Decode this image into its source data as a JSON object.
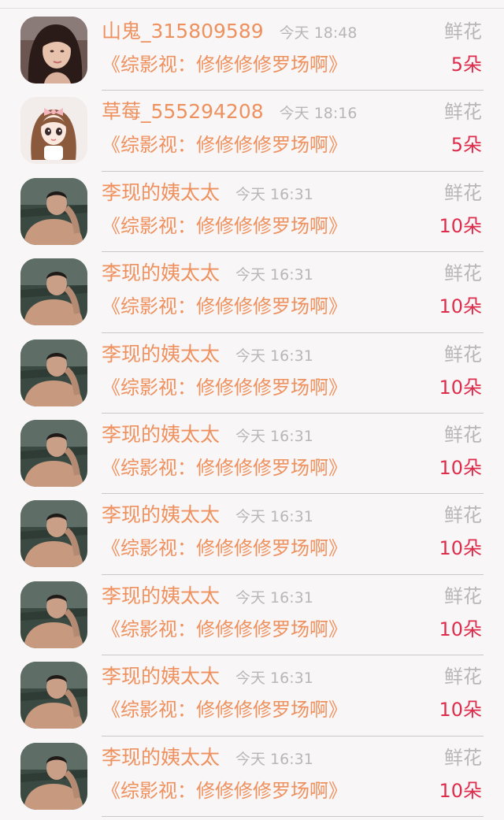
{
  "items": [
    {
      "name": "山鬼_315809589",
      "time": "今天 18:48",
      "gift": "鲜花",
      "book": "《综影视：修修修修罗场啊》",
      "count": "5朵",
      "avatar": "girl-dark-hair-avatar"
    },
    {
      "name": "草莓_555294208",
      "time": "今天 18:16",
      "gift": "鲜花",
      "book": "《综影视：修修修修罗场啊》",
      "count": "5朵",
      "avatar": "doll-girl-avatar"
    },
    {
      "name": "李现的姨太太",
      "time": "今天 16:31",
      "gift": "鲜花",
      "book": "《综影视：修修修修罗场啊》",
      "count": "10朵",
      "avatar": "man-photo-avatar"
    },
    {
      "name": "李现的姨太太",
      "time": "今天 16:31",
      "gift": "鲜花",
      "book": "《综影视：修修修修罗场啊》",
      "count": "10朵",
      "avatar": "man-photo-avatar"
    },
    {
      "name": "李现的姨太太",
      "time": "今天 16:31",
      "gift": "鲜花",
      "book": "《综影视：修修修修罗场啊》",
      "count": "10朵",
      "avatar": "man-photo-avatar"
    },
    {
      "name": "李现的姨太太",
      "time": "今天 16:31",
      "gift": "鲜花",
      "book": "《综影视：修修修修罗场啊》",
      "count": "10朵",
      "avatar": "man-photo-avatar"
    },
    {
      "name": "李现的姨太太",
      "time": "今天 16:31",
      "gift": "鲜花",
      "book": "《综影视：修修修修罗场啊》",
      "count": "10朵",
      "avatar": "man-photo-avatar"
    },
    {
      "name": "李现的姨太太",
      "time": "今天 16:31",
      "gift": "鲜花",
      "book": "《综影视：修修修修罗场啊》",
      "count": "10朵",
      "avatar": "man-photo-avatar"
    },
    {
      "name": "李现的姨太太",
      "time": "今天 16:31",
      "gift": "鲜花",
      "book": "《综影视：修修修修罗场啊》",
      "count": "10朵",
      "avatar": "man-photo-avatar"
    },
    {
      "name": "李现的姨太太",
      "time": "今天 16:31",
      "gift": "鲜花",
      "book": "《综影视：修修修修罗场啊》",
      "count": "10朵",
      "avatar": "man-photo-avatar"
    }
  ],
  "colors": {
    "name": "#ee915e",
    "muted": "#b8b6b7",
    "count": "#de2d4c",
    "background": "#f8f6f7"
  }
}
